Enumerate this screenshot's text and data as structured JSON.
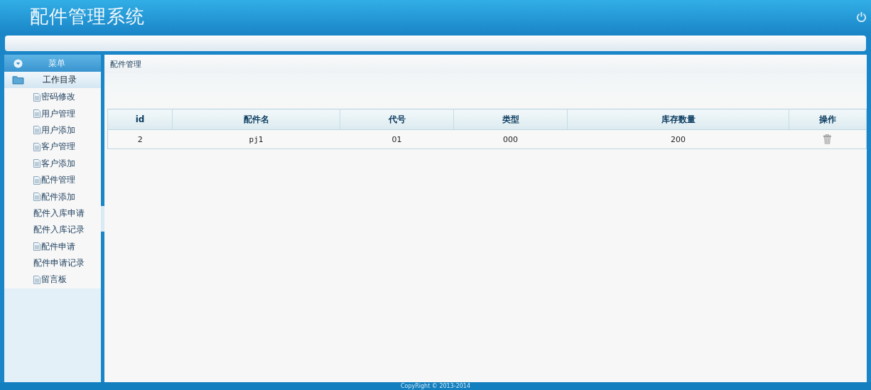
{
  "header": {
    "title": "配件管理系统"
  },
  "sidebar": {
    "menu_title": "菜单",
    "group": {
      "label": "工作目录",
      "expanded": true
    },
    "items": [
      {
        "label": "密码修改",
        "icon": true
      },
      {
        "label": "用户管理",
        "icon": true
      },
      {
        "label": "用户添加",
        "icon": true
      },
      {
        "label": "客户管理",
        "icon": true
      },
      {
        "label": "客户添加",
        "icon": true
      },
      {
        "label": "配件管理",
        "icon": true
      },
      {
        "label": "配件添加",
        "icon": true
      },
      {
        "label": "配件入库申请",
        "icon": false
      },
      {
        "label": "配件入库记录",
        "icon": false
      },
      {
        "label": "配件申请",
        "icon": true
      },
      {
        "label": "配件申请记录",
        "icon": false
      },
      {
        "label": "留言板",
        "icon": true
      }
    ]
  },
  "main": {
    "title": "配件管理",
    "table": {
      "columns": [
        "id",
        "配件名",
        "代号",
        "类型",
        "库存数量",
        "操作"
      ],
      "rows": [
        {
          "cells": [
            "2",
            "pj1",
            "01",
            "000",
            "200"
          ]
        }
      ]
    }
  },
  "footer": {
    "text": "CopyRight © 2013-2014"
  }
}
